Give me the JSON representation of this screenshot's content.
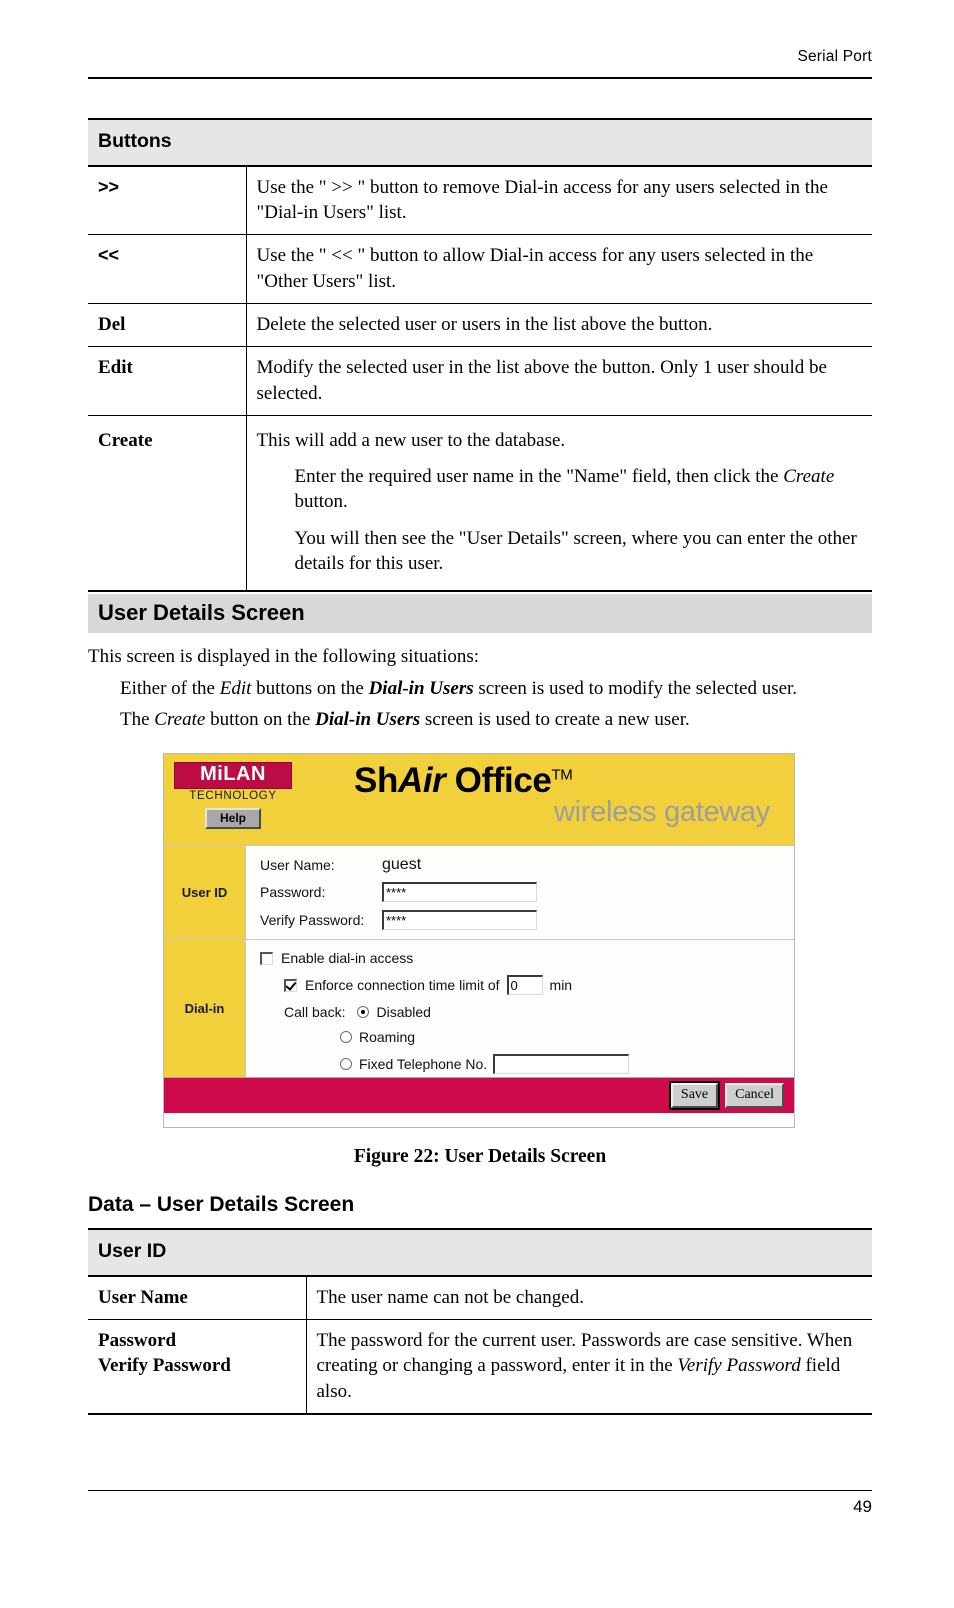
{
  "running_head": "Serial Port",
  "page_number": "49",
  "buttons_table": {
    "header": "Buttons",
    "rows": [
      {
        "key": ">>",
        "desc": "Use the \" >> \" button to remove Dial-in access for any users selected in the \"Dial-in Users\" list."
      },
      {
        "key": "<<",
        "desc": "Use the \" << \" button to allow Dial-in access for any users selected in the \"Other Users\" list."
      },
      {
        "key": "Del",
        "desc": "Delete the selected user or users in the list above the button."
      },
      {
        "key": "Edit",
        "desc": "Modify the selected user in the list above the button. Only 1 user should be selected."
      },
      {
        "key": "Create",
        "desc_lead": "This will add a new user to the database.",
        "desc_p1_a": "Enter the required user name in the \"Name\" field, then click the ",
        "desc_p1_em": "Create",
        "desc_p1_b": " button.",
        "desc_p2": "You will then see the \"User Details\" screen, where you can enter the other details for this user."
      }
    ]
  },
  "section": {
    "title": "User Details Screen",
    "intro": "This screen is displayed in the following situations:",
    "bullet1_a": "Either of the ",
    "bullet1_em": "Edit",
    "bullet1_b": " buttons on the ",
    "bullet1_bi": "Dial-in Users",
    "bullet1_c": " screen is used to modify the selected user.",
    "bullet2_a": "The ",
    "bullet2_em": "Create",
    "bullet2_b": " button on the ",
    "bullet2_bi": "Dial-in Users",
    "bullet2_c": " screen is used to create a new user."
  },
  "screenshot": {
    "logo": {
      "brand": "MiLAN",
      "tagline": "TECHNOLOGY",
      "help_label": "Help"
    },
    "product": {
      "name_part1": "Sh",
      "name_part2": "Air",
      "name_part3": " Office",
      "trademark": "TM",
      "subtitle": "wireless gateway"
    },
    "userid_section": {
      "side_label": "User ID",
      "user_name_label": "User Name:",
      "user_name_value": "guest",
      "password_label": "Password:",
      "password_value": "****",
      "verify_label": "Verify Password:",
      "verify_value": "****"
    },
    "dialin_section": {
      "side_label": "Dial-in",
      "enable_label": "Enable dial-in access",
      "enable_checked": false,
      "enforce_label": "Enforce connection time limit of",
      "enforce_checked": true,
      "enforce_value": "0",
      "enforce_unit": "min",
      "callback_label": "Call back:",
      "callback_options": [
        {
          "label": "Disabled",
          "selected": true
        },
        {
          "label": "Roaming",
          "selected": false
        },
        {
          "label": "Fixed Telephone No.",
          "selected": false
        }
      ],
      "phone_value": ""
    },
    "footer": {
      "save_label": "Save",
      "cancel_label": "Cancel",
      "bar_color": "#ce0a4c"
    },
    "colors": {
      "banner_yellow": "#f2d03c",
      "logo_red": "#bd0b46",
      "footer_crimson": "#ce0a4c",
      "subtitle_gray": "#9e9e9e"
    }
  },
  "figure_caption": "Figure 22: User Details Screen",
  "data_heading": "Data – User Details Screen",
  "data_table": {
    "header": "User ID",
    "rows": [
      {
        "key": "User Name",
        "desc": "The user name can not be changed."
      },
      {
        "key_line1": "Password",
        "key_line2": "Verify Password",
        "desc_a": "The password for the current user. Passwords are case sensitive. When creating or changing a password, enter it in the ",
        "desc_em": "Verify Password",
        "desc_b": " field also."
      }
    ]
  }
}
